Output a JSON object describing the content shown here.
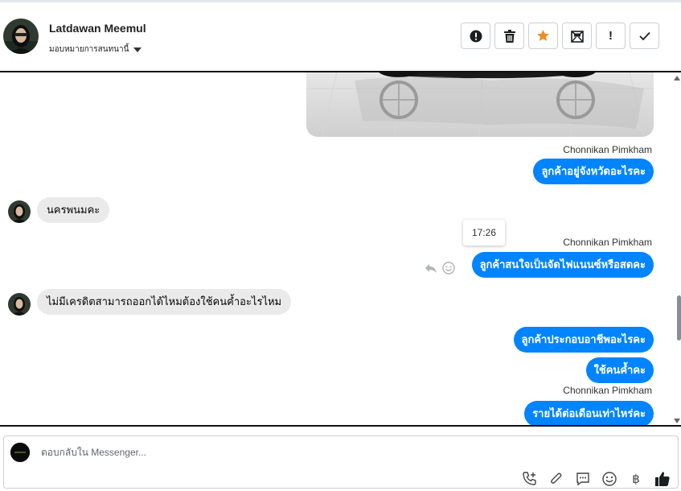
{
  "header": {
    "contact_name": "Latdawan Meemul",
    "assignee_label": "มอบหมายการสนทนานี้",
    "actions": [
      {
        "icon": "alert-circle-icon"
      },
      {
        "icon": "trash-icon"
      },
      {
        "icon": "star-icon",
        "color": "#f28b1d"
      },
      {
        "icon": "mail-icon"
      },
      {
        "icon": "exclamation-icon",
        "label": "!"
      },
      {
        "icon": "check-icon"
      }
    ]
  },
  "chat": {
    "messages": [
      {
        "from": "page",
        "sender": "Chonnikan Pimkham",
        "text": "ลูกค้าอยู่จังหวัดอะไรคะ"
      },
      {
        "from": "customer",
        "text": "นครพนมคะ"
      },
      {
        "from": "page",
        "sender": "Chonnikan Pimkham",
        "text": "ลูกค้าสนใจเป็นจัดไฟแนนซ์หรือสดคะ",
        "tooltip_time": "17:26"
      },
      {
        "from": "customer",
        "text": "ไม่มีเครดิตสามารถออกได้ไหมต้องใช้คนค้ำอะไรไหม"
      },
      {
        "from": "page",
        "text": "ลูกค้าประกอบอาชีพอะไรคะ"
      },
      {
        "from": "page",
        "text": "ใช้คนค้ำคะ"
      },
      {
        "from": "page",
        "sender": "Chonnikan Pimkham",
        "text": "รายได้ต่อเดือนเท่าไหร่คะ"
      }
    ]
  },
  "composer": {
    "placeholder": "ตอบกลับใน Messenger...",
    "tools": [
      "call-add-icon",
      "attachment-icon",
      "saved-reply-icon",
      "emoji-icon",
      "baht-icon",
      "thumbs-up-icon"
    ],
    "currency_symbol": "฿"
  },
  "colors": {
    "accent": "#0084ff",
    "incoming_bubble": "#eaeaea",
    "star": "#f28b1d"
  }
}
